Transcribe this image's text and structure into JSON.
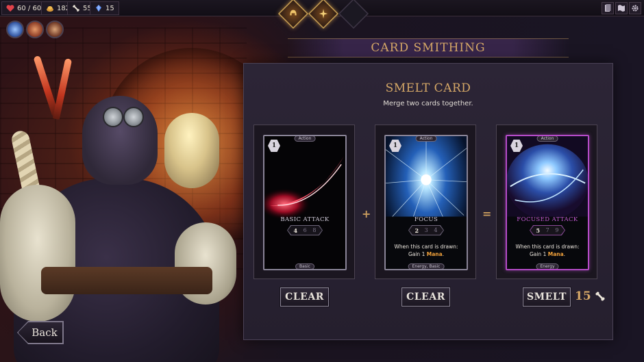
{
  "stats": {
    "health": "60 / 60",
    "gold": "182",
    "bones": "55",
    "gems": "15"
  },
  "page_title": "CARD SMITHING",
  "panel": {
    "title": "SMELT CARD",
    "subtitle": "Merge two cards together."
  },
  "cards": [
    {
      "cost": "1",
      "type_tag": "Action",
      "name": "BASIC ATTACK",
      "levels": [
        "4",
        "6",
        "8"
      ],
      "description": "",
      "description_keyword": "",
      "bottom_tag": "Basic"
    },
    {
      "cost": "1",
      "type_tag": "Action",
      "name": "FOCUS",
      "levels": [
        "2",
        "3",
        "4"
      ],
      "description": "When this card is drawn: Gain 1",
      "description_keyword": "Mana",
      "bottom_tag": "Energy, Basic"
    },
    {
      "cost": "1",
      "type_tag": "Action",
      "name": "FOCUSED ATTACK",
      "levels": [
        "5",
        "7",
        "9"
      ],
      "description": "When this card is drawn: Gain 1",
      "description_keyword": "Mana",
      "bottom_tag": "Energy"
    }
  ],
  "operators": {
    "plus": "+",
    "equals": "="
  },
  "buttons": {
    "clear_left": "CLEAR",
    "clear_right": "CLEAR",
    "smelt": "SMELT",
    "smelt_cost": "15",
    "back": "Back"
  },
  "icons": {
    "health": "heart-icon",
    "gold": "gold-pile-icon",
    "bones": "bone-icon",
    "gems": "gem-icon",
    "cost_currency": "bone-icon"
  },
  "colors": {
    "accent_gold": "#d6a867",
    "mana_keyword": "#f2a23b",
    "rare_border": "#b54bc8",
    "health_red": "#e0424a",
    "gem_blue": "#5a8cf0"
  }
}
